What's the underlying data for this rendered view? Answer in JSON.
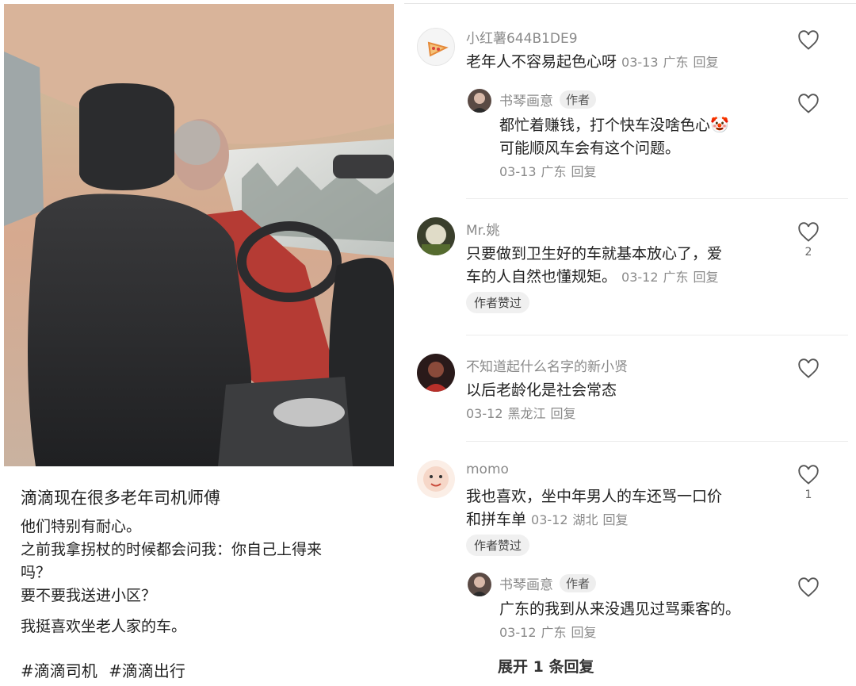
{
  "post": {
    "title": "滴滴现在很多老年司机师傅",
    "lines": [
      "他们特别有耐心。",
      "之前我拿拐杖的时候都会问我：你自己上得来",
      "吗？",
      "要不要我送进小区？"
    ],
    "closing": "我挺喜欢坐老人家的车。",
    "hashtags": [
      "#滴滴司机",
      "#滴滴出行"
    ]
  },
  "comments": [
    {
      "username": "小红薯644B1DE9",
      "text": "老年人不容易起色心呀",
      "date": "03-13",
      "location": "广东",
      "reply": "回复",
      "likes": ""
    },
    {
      "username": "书琴画意",
      "badge": "作者",
      "text_line1": "都忙着赚钱，打个快车没啥色心🤡",
      "text_line2": "可能顺风车会有这个问题。",
      "date": "03-13",
      "location": "广东",
      "reply": "回复"
    },
    {
      "username": "Mr.姚",
      "text_line1": "只要做到卫生好的车就基本放心了，爱",
      "text_line2": "车的人自然也懂规矩。",
      "date": "03-12",
      "location": "广东",
      "reply": "回复",
      "liked_by_author": "作者赞过",
      "likes": "2"
    },
    {
      "username": "不知道起什么名字的新小贤",
      "text": "以后老龄化是社会常态",
      "date": "03-12",
      "location": "黑龙江",
      "reply": "回复"
    },
    {
      "username": "momo",
      "text_line1": "我也喜欢，坐中年男人的车还骂一口价",
      "text_line2": "和拼车单",
      "date": "03-12",
      "location": "湖北",
      "reply": "回复",
      "liked_by_author": "作者赞过",
      "likes": "1"
    },
    {
      "username": "书琴画意",
      "badge": "作者",
      "text": "广东的我到从来没遇见过骂乘客的。",
      "date": "03-12",
      "location": "广东",
      "reply": "回复"
    }
  ],
  "expand_label": "展开 1 条回复",
  "icons": {
    "like": "heart-outline-icon"
  }
}
